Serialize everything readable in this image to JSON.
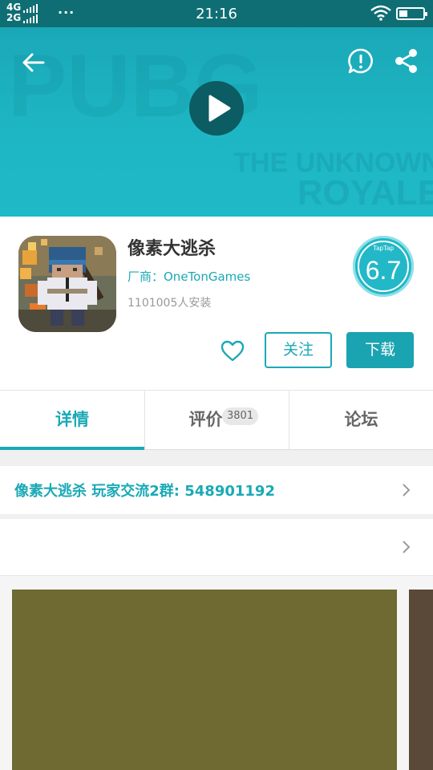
{
  "status_bar": {
    "network_top": "4G",
    "network_bottom": "2G",
    "dots": "···",
    "time": "21:16"
  },
  "hero": {
    "bg_text_1": "THE UNKNOWN",
    "bg_text_2": "ROYALE"
  },
  "app": {
    "title": "像素大逃杀",
    "vendor": "厂商：OneTonGames",
    "installs": "1101005人安装",
    "score_brand": "TapTap",
    "score": "6.7",
    "follow_label": "关注",
    "download_label": "下载"
  },
  "tabs": [
    {
      "label": "详情"
    },
    {
      "label": "评价",
      "badge": "3801"
    },
    {
      "label": "论坛"
    }
  ],
  "group_row": {
    "text": "像素大逃杀  玩家交流2群:  548901192"
  },
  "colors": {
    "accent": "#1aa9b6",
    "status_bar": "#0f6e74",
    "hero": "#1eb6c4"
  }
}
